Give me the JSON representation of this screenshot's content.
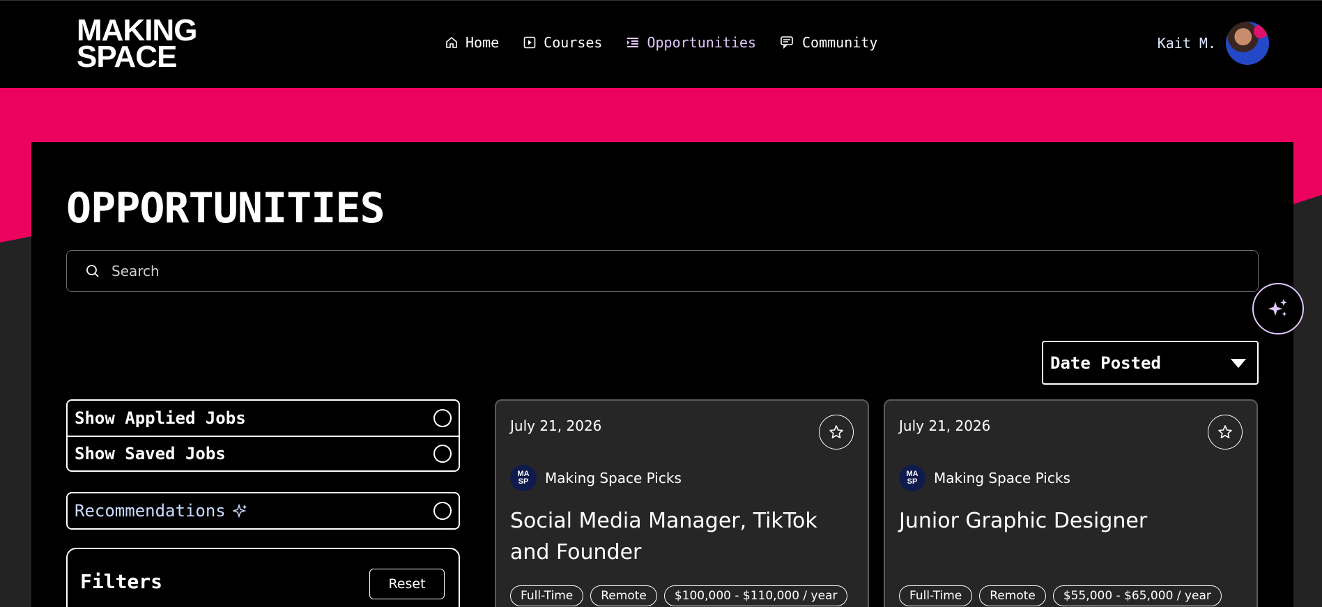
{
  "logo": {
    "line1": "MAKING",
    "line2": "SPACE"
  },
  "nav": {
    "items": [
      {
        "label": "Home",
        "icon": "home-icon",
        "active": false
      },
      {
        "label": "Courses",
        "icon": "play-icon",
        "active": false
      },
      {
        "label": "Opportunities",
        "icon": "list-icon",
        "active": true
      },
      {
        "label": "Community",
        "icon": "chat-icon",
        "active": false
      }
    ],
    "active_color": "#e2c7ff"
  },
  "user": {
    "name": "Kait M."
  },
  "page": {
    "title": "OPPORTUNITIES",
    "accent": "#ec035e"
  },
  "search": {
    "placeholder": "Search",
    "value": ""
  },
  "sort": {
    "selected": "Date Posted"
  },
  "toggles": {
    "applied": "Show Applied Jobs",
    "saved": "Show Saved Jobs",
    "recommendations": "Recommendations"
  },
  "filters": {
    "title": "Filters",
    "reset_label": "Reset"
  },
  "cards": [
    {
      "date": "July 21, 2026",
      "badge_line1": "MA",
      "badge_line2": "SP",
      "source": "Making Space Picks",
      "title": "Social Media Manager, TikTok and Founder",
      "tags": [
        "Full-Time",
        "Remote",
        "$100,000 - $110,000 / year"
      ]
    },
    {
      "date": "July 21, 2026",
      "badge_line1": "MA",
      "badge_line2": "SP",
      "source": "Making Space Picks",
      "title": "Junior Graphic Designer",
      "tags": [
        "Full-Time",
        "Remote",
        "$55,000 - $65,000 / year"
      ]
    }
  ]
}
